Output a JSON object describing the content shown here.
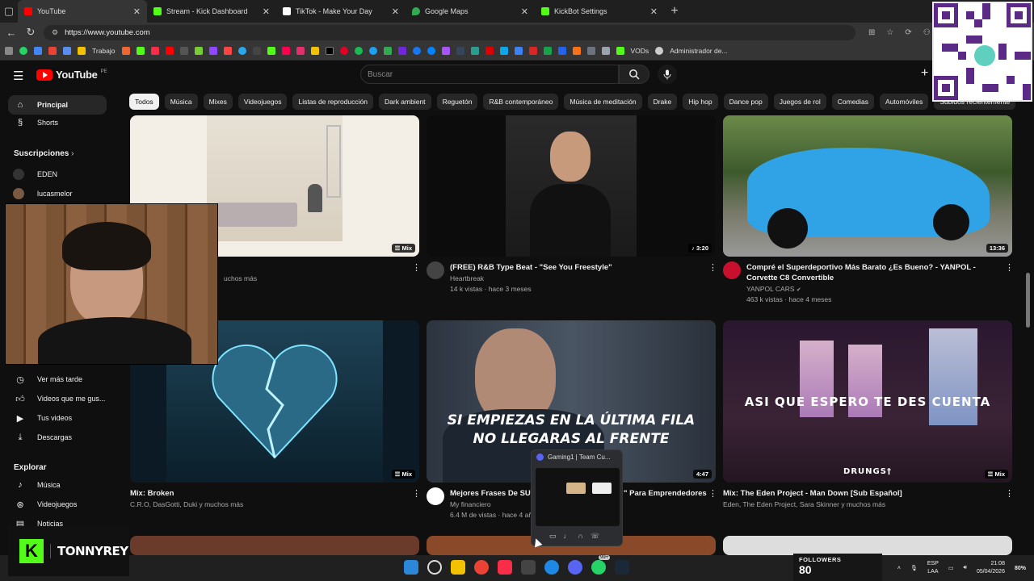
{
  "browser": {
    "tabs": [
      {
        "title": "YouTube",
        "color": "#ff0000",
        "active": true
      },
      {
        "title": "Stream - Kick Dashboard",
        "color": "#53fc18"
      },
      {
        "title": "TikTok - Make Your Day",
        "color": "#ffffff"
      },
      {
        "title": "Google Maps",
        "color": "#34a853"
      },
      {
        "title": "KickBot Settings",
        "color": "#53fc18"
      }
    ],
    "url": "https://www.youtube.com",
    "bookmarks": {
      "trabajo": "Trabajo",
      "vods": "VODs",
      "admin": "Administrador de..."
    }
  },
  "youtube": {
    "logo": "YouTube",
    "country": "PE",
    "search_placeholder": "Buscar",
    "sidebar": {
      "principal": "Principal",
      "shorts": "Shorts",
      "subscriptions_header": "Suscripciones",
      "channels": [
        "EDEN",
        "lucasmelor"
      ],
      "watch_later": "Ver más tarde",
      "liked": "Videos que me gus...",
      "your_videos": "Tus videos",
      "downloads": "Descargas",
      "explore_header": "Explorar",
      "music": "Música",
      "gaming": "Videojuegos",
      "news": "Noticias"
    },
    "chips": [
      "Todos",
      "Música",
      "Mixes",
      "Videojuegos",
      "Listas de reproducción",
      "Dark ambient",
      "Reguetón",
      "R&B contemporáneo",
      "Música de meditación",
      "Drake",
      "Hip hop",
      "Dance pop",
      "Juegos de rol",
      "Comedias",
      "Automóviles",
      "Subidos recientemente"
    ],
    "videos": {
      "v1": {
        "badge": "Mix",
        "meta": "uchos más"
      },
      "v2": {
        "duration": "3:20",
        "title": "(FREE) R&B Type Beat - \"See You Freestyle\"",
        "channel": "Heartbreak",
        "stats": "14 k vistas · hace 3 meses"
      },
      "v3": {
        "duration": "13:36",
        "title": "Compré el Superdeportivo Más Barato ¿Es Bueno? - YANPOL - Corvette C8 Convertible",
        "channel": "YANPOL CARS",
        "stats": "463 k vistas · hace 4 meses"
      },
      "v4": {
        "badge": "Mix",
        "title": "Mix: Broken",
        "meta": "C.R.O, DasGotti, Duki y muchos más"
      },
      "v5": {
        "duration": "4:47",
        "overlay1": "SI EMPIEZAS EN LA ÚLTIMA FILA",
        "overlay2": "NO LLEGARAS AL FRENTE",
        "title_a": "Mejores Frases De SUI",
        "title_b": "\" Para Emprendedores",
        "channel": "My financiero",
        "stats": "6.4 M de vistas · hace 4 añ"
      },
      "v6": {
        "badge": "Mix",
        "overlay": "ASI QUE ESPERO TE DES CUENTA",
        "watermark": "DRUNGS†",
        "title": "Mix: The Eden Project - Man Down [Sub Español]",
        "meta": "Eden, The Eden Project, Sara Skinner y muchos más"
      }
    }
  },
  "overlays": {
    "popup_title": "Gaming1 | Team Cu...",
    "brand": "TONNYREY",
    "brand_letter": "K",
    "followers_label": "FOLLOWERS",
    "followers_count": "80"
  },
  "taskbar": {
    "lang": "ESP",
    "lang2": "LAA",
    "time": "21:08",
    "date": "05/04/2026",
    "battery": "80%",
    "badge": "99+"
  }
}
